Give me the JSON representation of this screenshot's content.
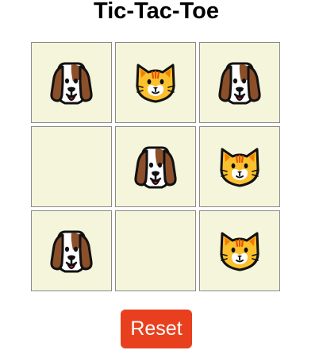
{
  "title": "Tic-Tac-Toe",
  "board": [
    {
      "piece": "dog"
    },
    {
      "piece": "cat"
    },
    {
      "piece": "dog"
    },
    {
      "piece": ""
    },
    {
      "piece": "dog"
    },
    {
      "piece": "cat"
    },
    {
      "piece": "dog"
    },
    {
      "piece": ""
    },
    {
      "piece": "cat"
    }
  ],
  "pieces": {
    "dog": {
      "icon": "dog-face-icon"
    },
    "cat": {
      "icon": "cat-face-icon"
    }
  },
  "reset_label": "Reset",
  "colors": {
    "cell_bg": "#f5f5dc",
    "cell_border": "#8a8a8a",
    "reset_bg": "#e8401f",
    "reset_text": "#ffffff"
  }
}
